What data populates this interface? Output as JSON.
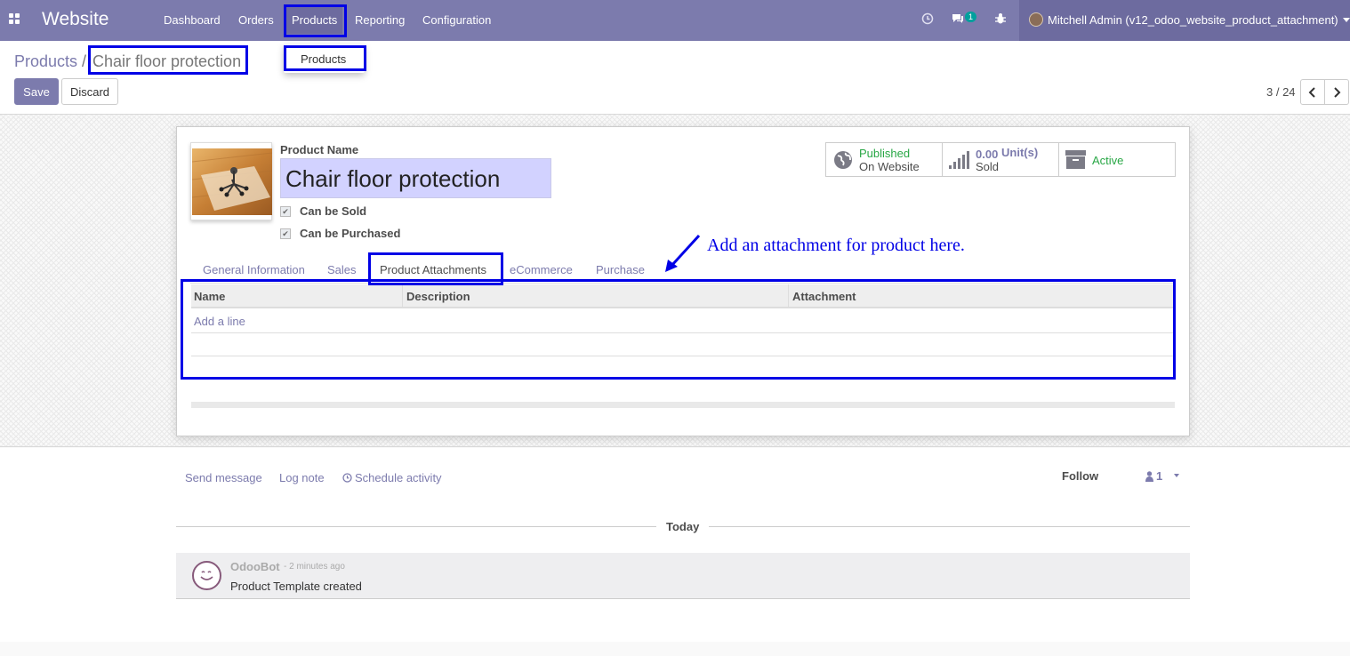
{
  "navbar": {
    "brand": "Website",
    "menus": [
      "Dashboard",
      "Orders",
      "Products",
      "Reporting",
      "Configuration"
    ],
    "active_menu": "Products",
    "chat_badge": "1",
    "user": "Mitchell Admin (v12_odoo_website_product_attachment)",
    "icons": [
      "apps-grid-icon",
      "clock-icon",
      "chat-icon",
      "bug-icon",
      "user-avatar"
    ]
  },
  "dropdown": {
    "items": [
      "Products"
    ]
  },
  "breadcrumb": {
    "parent": "Products",
    "separator": "/",
    "current": "Chair floor protection"
  },
  "buttons": {
    "save": "Save",
    "discard": "Discard"
  },
  "pager": {
    "value": "3 / 24"
  },
  "form": {
    "product_name_label": "Product Name",
    "product_name": "Chair floor protection",
    "can_be_sold": "Can be Sold",
    "can_be_purchased": "Can be Purchased",
    "can_be_sold_checked": true,
    "can_be_purchased_checked": true
  },
  "stat_buttons": {
    "published_line1": "Published",
    "published_line2": "On Website",
    "sold_value": "0.00",
    "sold_unit": "Unit(s)",
    "sold_label": "Sold",
    "active_label": "Active"
  },
  "tabs": [
    "General Information",
    "Sales",
    "Product Attachments",
    "eCommerce",
    "Purchase"
  ],
  "active_tab": "Product Attachments",
  "table": {
    "columns": [
      "Name",
      "Description",
      "Attachment"
    ],
    "add_line": "Add a line"
  },
  "annotation": "Add an attachment for product here.",
  "chatter": {
    "send_message": "Send message",
    "log_note": "Log note",
    "schedule_activity": "Schedule activity",
    "follow": "Follow",
    "followers_count": "1",
    "date_separator": "Today",
    "message": {
      "author": "OdooBot",
      "date": "- 2 minutes ago",
      "body": "Product Template created"
    }
  },
  "colors": {
    "navbar": "#7c7bad",
    "highlight": "#0000e6",
    "published": "#28a745",
    "name_input_bg": "#d2d2ff"
  }
}
